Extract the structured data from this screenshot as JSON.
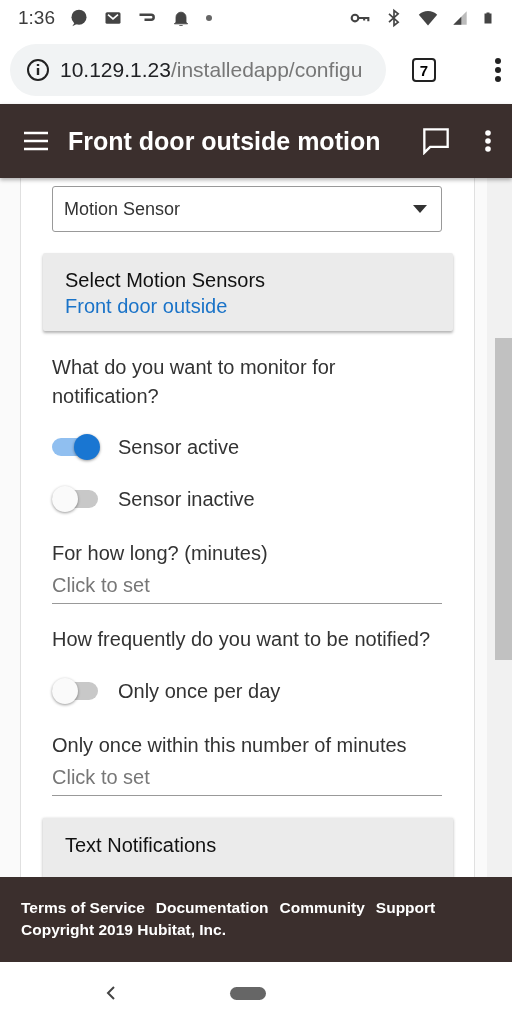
{
  "status_bar": {
    "time": "1:36"
  },
  "address_bar": {
    "url_host": "10.129.1.23",
    "url_path": "/installedapp/configu",
    "tab_count": "7"
  },
  "app_bar": {
    "title": "Front door outside motion"
  },
  "form": {
    "device_type_select": {
      "value": "Motion Sensor"
    },
    "device_picker": {
      "title": "Select Motion Sensors",
      "value": "Front door outside"
    },
    "items": [
      {
        "kind": "question",
        "text": "What do you want to monitor for notification?"
      },
      {
        "kind": "toggle",
        "label": "Sensor active",
        "on": true
      },
      {
        "kind": "toggle",
        "label": "Sensor inactive",
        "on": false
      },
      {
        "kind": "input",
        "label": "For how long? (minutes)",
        "placeholder": "Click to set"
      },
      {
        "kind": "question",
        "text": "How frequently do you want to be notified?"
      },
      {
        "kind": "toggle",
        "label": "Only once per day",
        "on": false
      },
      {
        "kind": "input",
        "label": "Only once within this number of minutes",
        "placeholder": "Click to set"
      },
      {
        "kind": "section",
        "title": "Text Notifications"
      }
    ]
  },
  "footer": {
    "links": [
      "Terms of Service",
      "Documentation",
      "Community",
      "Support"
    ],
    "copyright": "Copyright 2019 Hubitat, Inc."
  }
}
